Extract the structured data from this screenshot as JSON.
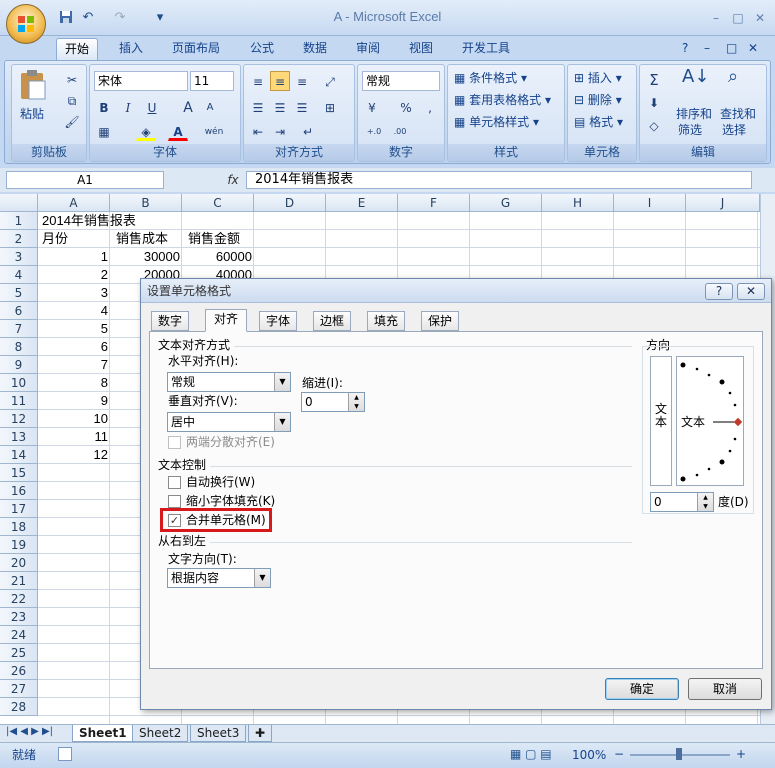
{
  "app": {
    "title": "A - Microsoft Excel",
    "window_controls": [
      "–",
      "□",
      "✕"
    ],
    "quick_access": {
      "save": "save-icon",
      "undo": "↶",
      "redo": "↷",
      "customize": "▾"
    }
  },
  "ribbon": {
    "tabs": [
      "开始",
      "插入",
      "页面布局",
      "公式",
      "数据",
      "审阅",
      "视图",
      "开发工具"
    ],
    "active_tab": "开始",
    "help_icons": [
      "?",
      "–",
      "□",
      "✕"
    ],
    "clipboard": {
      "label": "剪贴板",
      "paste": "粘贴"
    },
    "font": {
      "label": "字体",
      "name": "宋体",
      "size": "11",
      "bold": "B",
      "italic": "I",
      "underline": "U",
      "grow": "A",
      "shrink": "A",
      "color_a": "A",
      "wen": "wén"
    },
    "alignment": {
      "label": "对齐方式"
    },
    "number": {
      "label": "数字",
      "format": "常规",
      "percent": "%",
      "comma": ",",
      "inc": "+.0 .00",
      "dec": ".00 →.0"
    },
    "styles": {
      "label": "样式",
      "conditional": "条件格式",
      "table": "套用表格格式",
      "cell": "单元格样式"
    },
    "cells": {
      "label": "单元格",
      "insert": "插入",
      "delete": "删除",
      "format": "格式"
    },
    "editing": {
      "label": "编辑",
      "sigma": "Σ",
      "sort": "排序和",
      "sort2": "筛选",
      "find": "查找和",
      "find2": "选择"
    }
  },
  "formula_bar": {
    "name_box": "A1",
    "fx": "fx",
    "content": "2014年销售报表"
  },
  "sheet": {
    "columns": [
      "A",
      "B",
      "C",
      "D",
      "E",
      "F",
      "G",
      "H",
      "I",
      "J"
    ],
    "rows": [
      "1",
      "2",
      "3",
      "4",
      "5",
      "6",
      "7",
      "8",
      "9",
      "10",
      "11",
      "12",
      "13",
      "14",
      "15",
      "16",
      "17",
      "18",
      "19",
      "20",
      "21",
      "22",
      "23",
      "24",
      "25",
      "26",
      "27",
      "28"
    ],
    "cells": {
      "a1": "2014年销售报表",
      "a2": "月份",
      "b2": "销售成本",
      "c2": "销售金额",
      "a3": "1",
      "b3": "30000",
      "c3": "60000",
      "a4": "2",
      "b4": "20000",
      "c4": "40000",
      "a5": "3",
      "a6": "4",
      "a7": "5",
      "a8": "6",
      "a9": "7",
      "a10": "8",
      "a11": "9",
      "a12": "10",
      "a13": "11",
      "a14": "12"
    },
    "tabs": [
      "Sheet1",
      "Sheet2",
      "Sheet3"
    ],
    "active_sheet": "Sheet1"
  },
  "status": {
    "ready": "就绪",
    "zoom": "100%",
    "minus": "−",
    "plus": "+"
  },
  "dialog": {
    "title": "设置单元格格式",
    "help": "?",
    "close": "✕",
    "tabs": [
      "数字",
      "对齐",
      "字体",
      "边框",
      "填充",
      "保护"
    ],
    "active_tab": "对齐",
    "text_alignment_header": "文本对齐方式",
    "horizontal_label": "水平对齐(H):",
    "horizontal_value": "常规",
    "indent_label": "缩进(I):",
    "indent_value": "0",
    "vertical_label": "垂直对齐(V):",
    "vertical_value": "居中",
    "justify_distributed": "两端分散对齐(E)",
    "text_control_header": "文本控制",
    "wrap_text": "自动换行(W)",
    "shrink_to_fit": "缩小字体填充(K)",
    "merge_cells": "合并单元格(M)",
    "merge_checked": true,
    "rtl_header": "从右到左",
    "text_direction_label": "文字方向(T):",
    "text_direction_value": "根据内容",
    "orientation_header": "方向",
    "vertical_text": "文本",
    "orientation_text": "文本",
    "degrees_value": "0",
    "degrees_label": "度(D)",
    "ok": "确定",
    "cancel": "取消",
    "highlight_color": "#d7191c"
  }
}
